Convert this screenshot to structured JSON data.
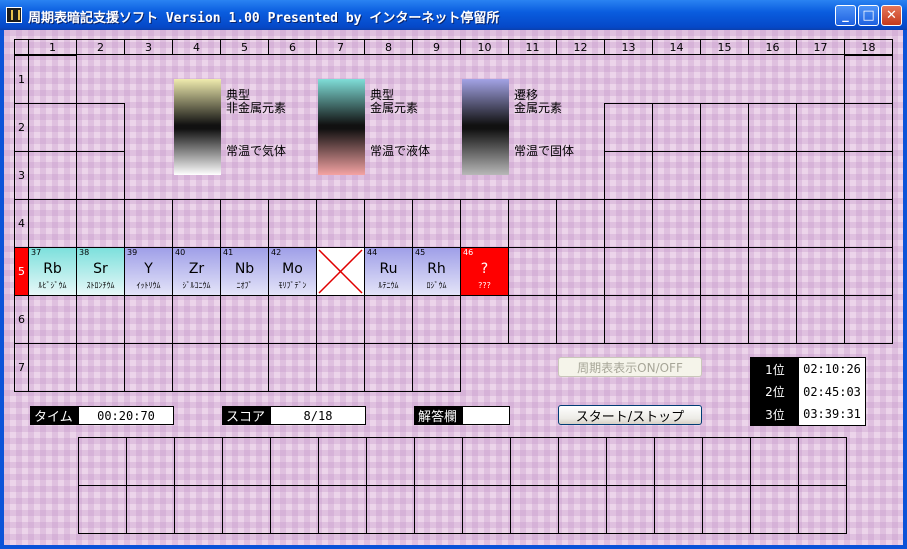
{
  "window": {
    "title": "周期表暗記支援ソフト Version 1.00 Presented by インターネット停留所",
    "buttons": {
      "minimize": "_",
      "maximize": "□",
      "close": "✕"
    }
  },
  "table": {
    "group_headers": [
      "1",
      "2",
      "3",
      "4",
      "5",
      "6",
      "7",
      "8",
      "9",
      "10",
      "11",
      "12",
      "13",
      "14",
      "15",
      "16",
      "17",
      "18"
    ],
    "period_headers": [
      "1",
      "2",
      "3",
      "4",
      "5",
      "6",
      "7"
    ],
    "active_period": "5",
    "elements": [
      {
        "number": "37",
        "symbol": "Rb",
        "name": "ﾙﾋﾞｼﾞｳﾑ",
        "style": "cyan"
      },
      {
        "number": "38",
        "symbol": "Sr",
        "name": "ｽﾄﾛﾝﾁｳﾑ",
        "style": "cyan"
      },
      {
        "number": "39",
        "symbol": "Y",
        "name": "ｲｯﾄﾘｳﾑ",
        "style": "blue"
      },
      {
        "number": "40",
        "symbol": "Zr",
        "name": "ｼﾞﾙｺﾆｳﾑ",
        "style": "blue"
      },
      {
        "number": "41",
        "symbol": "Nb",
        "name": "ﾆｵﾌﾞ",
        "style": "blue"
      },
      {
        "number": "42",
        "symbol": "Mo",
        "name": "ﾓﾘﾌﾞﾃﾞﾝ",
        "style": "blue"
      },
      {
        "number": "",
        "symbol": "",
        "name": "",
        "style": "missing"
      },
      {
        "number": "44",
        "symbol": "Ru",
        "name": "ﾙﾃﾆｳﾑ",
        "style": "blue"
      },
      {
        "number": "45",
        "symbol": "Rh",
        "name": "ﾛｼﾞｳﾑ",
        "style": "blue"
      },
      {
        "number": "46",
        "symbol": "?",
        "name": "???",
        "style": "current"
      }
    ]
  },
  "legend": [
    {
      "label": "典型\n非金属元素",
      "color": "#f0ecae"
    },
    {
      "label": "典型\n金属元素",
      "color": "#7fded8"
    },
    {
      "label": "遷移\n金属元素",
      "color": "#a3a3e6"
    },
    {
      "label": "常温で気体",
      "color": "#ffffff"
    },
    {
      "label": "常温で液体",
      "color": "#f4a3a3"
    },
    {
      "label": "常温で固体",
      "color": "#b8b8b8"
    }
  ],
  "status": {
    "time_label": "タイム",
    "time_value": "00:20:70",
    "score_label": "スコア",
    "score_value": "8/18",
    "answer_label": "解答欄",
    "answer_value": ""
  },
  "buttons": {
    "toggle_table": "周期表表示ON/OFF",
    "start_stop": "スタート/ストップ"
  },
  "ranking": [
    {
      "rank": "1位",
      "time": "02:10:26"
    },
    {
      "rank": "2位",
      "time": "02:45:03"
    },
    {
      "rank": "3位",
      "time": "03:39:31"
    }
  ]
}
